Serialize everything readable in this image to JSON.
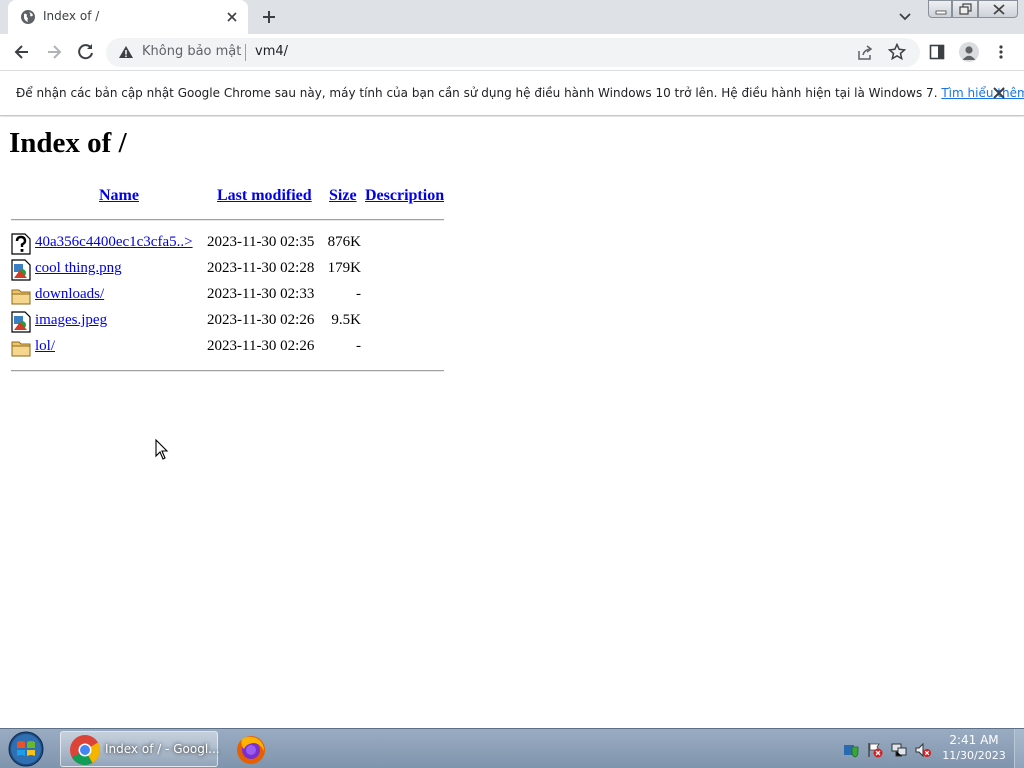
{
  "browser": {
    "tab_title": "Index of /",
    "security_label": "Không bảo mật",
    "url": "vm4/",
    "accent_color": "#1a73e8"
  },
  "infobar": {
    "message": "Để nhận các bản cập nhật Google Chrome sau này, máy tính của bạn cần sử dụng hệ điều hành Windows 10 trở lên. Hệ điều hành hiện tại là Windows 7.",
    "link_label": "Tìm hiểu thêm"
  },
  "listing": {
    "heading": "Index of /",
    "columns": {
      "name": "Name",
      "last_modified": "Last modified",
      "size": "Size",
      "description": "Description"
    },
    "rows": [
      {
        "icon": "unknown-file-icon",
        "name": "40a356c4400ec1c3cfa5..>",
        "modified": "2023-11-30 02:35",
        "size": "876K"
      },
      {
        "icon": "image-file-icon",
        "name": "cool thing.png",
        "modified": "2023-11-30 02:28",
        "size": "179K"
      },
      {
        "icon": "folder-icon",
        "name": "downloads/",
        "modified": "2023-11-30 02:33",
        "size": "-"
      },
      {
        "icon": "image-file-icon",
        "name": "images.jpeg",
        "modified": "2023-11-30 02:26",
        "size": "9.5K"
      },
      {
        "icon": "folder-icon",
        "name": "lol/",
        "modified": "2023-11-30 02:26",
        "size": "-"
      }
    ],
    "link_color": "#0000ee"
  },
  "taskbar": {
    "chrome_button_label": "Index of / - Googl...",
    "clock_time": "2:41 AM",
    "clock_date": "11/30/2023"
  }
}
